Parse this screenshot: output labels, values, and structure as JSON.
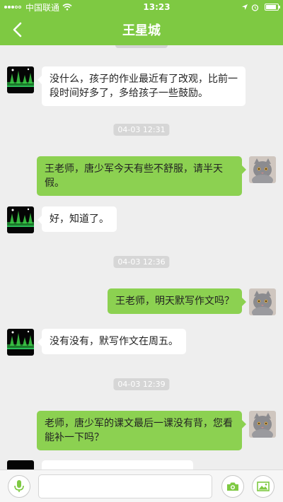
{
  "status_bar": {
    "carrier": "中国联通",
    "time": "13:23"
  },
  "header": {
    "title": "王星城"
  },
  "colors": {
    "accent": "#7ec942",
    "sent_bubble": "#8cd151",
    "received_bubble": "#ffffff",
    "background": "#eeeeee"
  },
  "messages": [
    {
      "side": "received",
      "avatar": "night-fountain-avatar",
      "text": "没什么，孩子的作业最近有了改观，比前一段时间好多了，多给孩子一些鼓励。"
    },
    {
      "time": "04-03 12:31"
    },
    {
      "side": "sent",
      "avatar": "gray-cat-avatar",
      "text": "王老师，唐少军今天有些不舒服，请半天假。"
    },
    {
      "side": "received",
      "avatar": "night-fountain-avatar",
      "text": "好，知道了。"
    },
    {
      "time": "04-03 12:36"
    },
    {
      "side": "sent",
      "avatar": "gray-cat-avatar",
      "text": "王老师，明天默写作文吗？"
    },
    {
      "side": "received",
      "avatar": "night-fountain-avatar",
      "text": "没有没有，默写作文在周五。"
    },
    {
      "time": "04-03 12:39"
    },
    {
      "side": "sent",
      "avatar": "gray-cat-avatar",
      "text": "老师，唐少军的课文最后一课没有背，您看能补一下吗？"
    }
  ],
  "input_bar": {
    "text_value": "",
    "left_icon": "microphone-icon",
    "right_icons": [
      "camera-icon",
      "image-icon"
    ]
  }
}
